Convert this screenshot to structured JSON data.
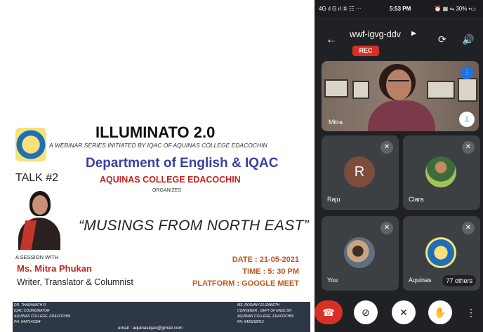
{
  "poster": {
    "title": "ILLUMINATO 2.0",
    "subtitle": "A WEBINAR SERIES INITIATED BY IQAC OF AQUINAS COLLEGE EDACOCHIN",
    "department": "Department of English & IQAC",
    "college": "AQUINAS COLLEGE EDACOCHIN",
    "organizes": "ORGANIZES",
    "talk": "TALK #2",
    "session_title": "“MUSINGS FROM NORTH EAST”",
    "session_with": "A SESSION WITH",
    "speaker_name": "Ms. Mitra Phukan",
    "speaker_role": "Writer, Translator & Columnist",
    "date": "DATE : 21-05-2021",
    "time": "TIME : 5: 30 PM",
    "platform": "PLATFORM : GOOGLE MEET",
    "footer": {
      "left_line1": "DR. THARANATH R",
      "left_line2": "IQAC COORDINATOR",
      "left_line3": "AQUINAS COLLEGE, EDACOCHIN",
      "left_line4": "PH: 9447149394",
      "email": "email : aquinasiqac@gmail.com",
      "right_line1": "MS. ROSHNY ELIZABETH",
      "right_line2": "CONVENER , DEPT OF ENGLISH",
      "right_line3": "AQUINAS COLLEGE, EDACOCHIN",
      "right_line4": "PH: 9495292013"
    }
  },
  "phone": {
    "status_left": "4G ıl  G ıl ⑤ ☷ ···",
    "time": "5:53 PM",
    "status_right": "⏰ ▦ ⇋ 30% ▪▭",
    "meeting_code": "wwf-igvg-ddv",
    "rec": "REC",
    "main_participant": "Mitra",
    "participants": [
      {
        "name": "Raju",
        "initial": "R"
      },
      {
        "name": "Clara"
      },
      {
        "name": "You"
      },
      {
        "name": "Aquinas",
        "others": "77 others"
      }
    ]
  }
}
